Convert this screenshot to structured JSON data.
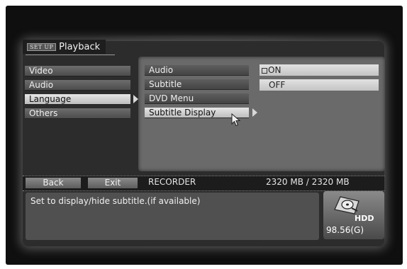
{
  "header": {
    "setup_badge": "SET UP",
    "title": "Playback"
  },
  "main_menu": {
    "items": [
      {
        "label": "Video"
      },
      {
        "label": "Audio"
      },
      {
        "label": "Language",
        "active": true
      },
      {
        "label": "Others"
      }
    ]
  },
  "sub_menu": {
    "items": [
      {
        "label": "Audio"
      },
      {
        "label": "Subtitle"
      },
      {
        "label": "DVD Menu"
      },
      {
        "label": "Subtitle Display",
        "active": true
      }
    ]
  },
  "options": {
    "items": [
      {
        "label": "ON",
        "selected": true
      },
      {
        "label": "OFF",
        "selected": false
      }
    ]
  },
  "bottom_bar": {
    "back_label": "Back",
    "exit_label": "Exit",
    "source": "RECORDER",
    "capacity": "2320 MB / 2320 MB"
  },
  "help": {
    "text": "Set to display/hide subtitle.(if available)"
  },
  "hdd": {
    "label": "HDD",
    "capacity": "98.56(G)",
    "icon": "hdd-icon"
  }
}
